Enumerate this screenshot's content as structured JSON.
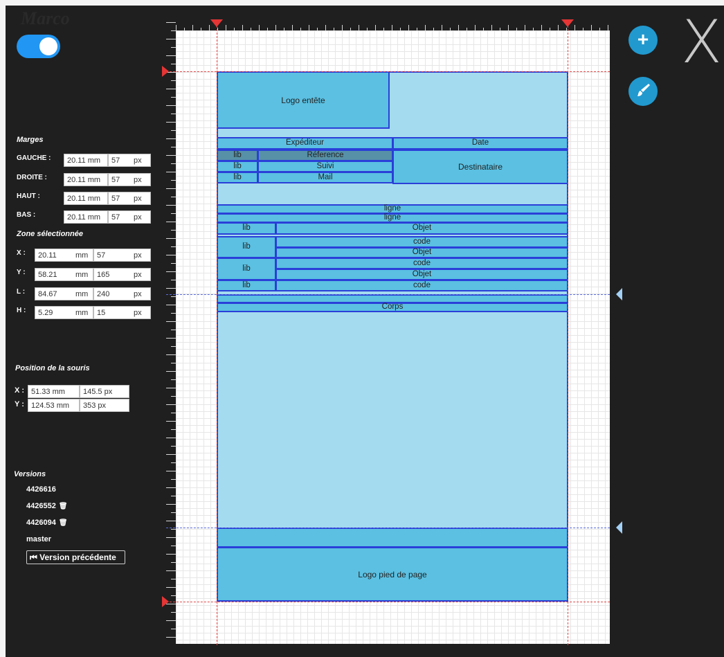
{
  "app": {
    "ghost_title": "Marco"
  },
  "margins": {
    "title": "Marges",
    "rows": [
      {
        "label": "GAUCHE :",
        "mm": "20.11 mm",
        "px": "57",
        "unit": "px"
      },
      {
        "label": "DROITE :",
        "mm": "20.11 mm",
        "px": "57",
        "unit": "px"
      },
      {
        "label": "HAUT :",
        "mm": "20.11 mm",
        "px": "57",
        "unit": "px"
      },
      {
        "label": "BAS :",
        "mm": "20.11 mm",
        "px": "57",
        "unit": "px"
      }
    ]
  },
  "selection": {
    "title": "Zone sélectionnée",
    "rows": [
      {
        "label": "X :",
        "mm": "20.11",
        "mm_unit": "mm",
        "px": "57",
        "px_unit": "px"
      },
      {
        "label": "Y :",
        "mm": "58.21",
        "mm_unit": "mm",
        "px": "165",
        "px_unit": "px"
      },
      {
        "label": "L :",
        "mm": "84.67",
        "mm_unit": "mm",
        "px": "240",
        "px_unit": "px"
      },
      {
        "label": "H :",
        "mm": "5.29",
        "mm_unit": "mm",
        "px": "15",
        "px_unit": "px"
      }
    ]
  },
  "mouse": {
    "title": "Position de la souris",
    "rows": [
      {
        "label": "X :",
        "mm": "51.33 mm",
        "px": "145.5 px"
      },
      {
        "label": "Y :",
        "mm": "124.53 mm",
        "px": "353 px"
      }
    ]
  },
  "versions": {
    "title": "Versions",
    "items": [
      "4426616",
      "4426552",
      "4426094",
      "master"
    ],
    "trash_icon": "🗑",
    "prev_button": "⏮ Version précédente"
  },
  "zones": {
    "logo_header": "Logo entête",
    "sender": "Expéditeur",
    "date": "Date",
    "lib": "lib",
    "reference": "Réference",
    "suivi": "Suivi",
    "mail": "Mail",
    "recipient": "Destinataire",
    "ligne": "ligne",
    "objet": "Objet",
    "code": "code",
    "body": "Corps",
    "logo_footer": "Logo pied de page"
  },
  "icons": {
    "add": "+",
    "brush": "brush-icon",
    "close": "X"
  },
  "colors": {
    "accent": "#2196f3",
    "zone": "#5bc0e2",
    "zone_border": "#2a3fd8",
    "content_bg": "#a5dbef",
    "guide": "#e04848"
  }
}
